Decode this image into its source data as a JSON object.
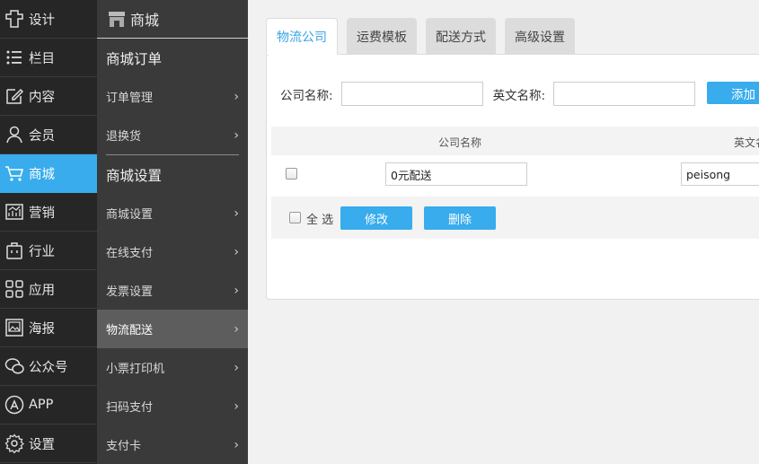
{
  "primary_nav": [
    {
      "label": "设计",
      "icon": "design-icon"
    },
    {
      "label": "栏目",
      "icon": "list-icon"
    },
    {
      "label": "内容",
      "icon": "edit-icon"
    },
    {
      "label": "会员",
      "icon": "user-icon"
    },
    {
      "label": "商城",
      "icon": "cart-icon",
      "active": true
    },
    {
      "label": "营销",
      "icon": "chart-icon"
    },
    {
      "label": "行业",
      "icon": "briefcase-icon"
    },
    {
      "label": "应用",
      "icon": "apps-icon"
    },
    {
      "label": "海报",
      "icon": "poster-icon"
    },
    {
      "label": "公众号",
      "icon": "wechat-icon"
    },
    {
      "label": "APP",
      "icon": "app-store-icon"
    },
    {
      "label": "设置",
      "icon": "gear-icon"
    }
  ],
  "secondary_nav": {
    "header": "商城",
    "section1": "商城订单",
    "section1_items": [
      "订单管理",
      "退换货"
    ],
    "section2": "商城设置",
    "section2_items": [
      "商城设置",
      "在线支付",
      "发票设置",
      "物流配送",
      "小票打印机",
      "扫码支付",
      "支付卡"
    ],
    "active_item": "物流配送"
  },
  "tabs": [
    "物流公司",
    "运费模板",
    "配送方式",
    "高级设置"
  ],
  "form": {
    "company_label": "公司名称:",
    "company_value": "",
    "english_label": "英文名称:",
    "english_value": "",
    "add_label": "添加"
  },
  "table": {
    "headers": [
      "公司名称",
      "英文名"
    ],
    "rows": [
      {
        "company": "0元配送",
        "english": "peisong",
        "checked": false
      }
    ]
  },
  "footer": {
    "select_all": "全 选",
    "edit": "修改",
    "delete": "删除"
  },
  "colors": {
    "accent": "#38acec",
    "nav_dark": "#262626",
    "nav_secondary": "#3a3a3a"
  }
}
